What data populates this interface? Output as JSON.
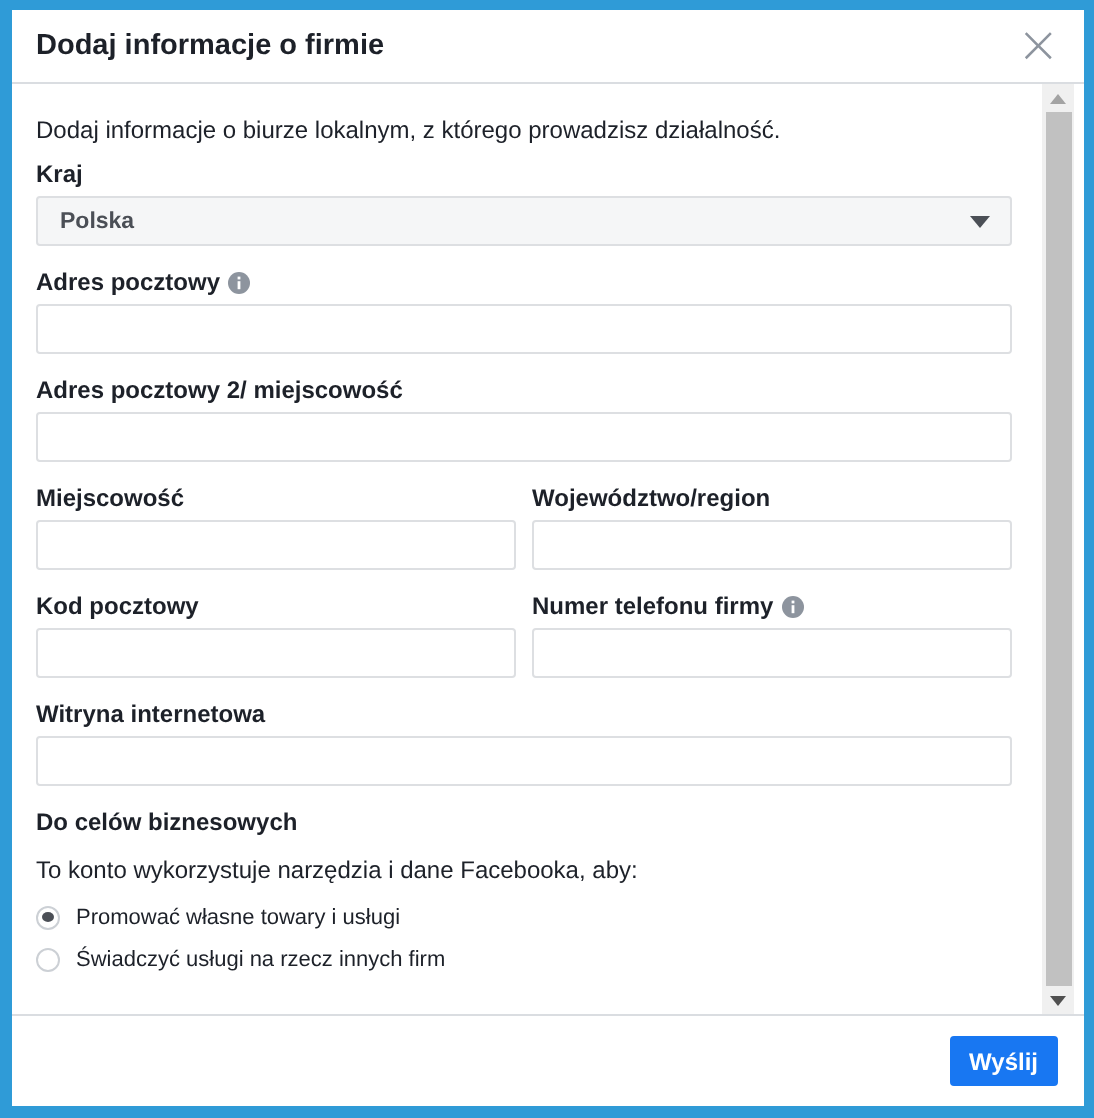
{
  "dialog": {
    "title": "Dodaj informacje o firmie",
    "close": "×"
  },
  "intro": "Dodaj informacje o biurze lokalnym, z którego prowadzisz działalność.",
  "rows": [
    {
      "fields": [
        {
          "kind": "select",
          "label": "Kraj",
          "info": false,
          "value": "Polska"
        }
      ]
    },
    {
      "fields": [
        {
          "kind": "text",
          "label": "Adres pocztowy",
          "info": true
        }
      ]
    },
    {
      "fields": [
        {
          "kind": "text",
          "label": "Adres pocztowy 2/ miejscowość",
          "info": false
        }
      ]
    },
    {
      "fields": [
        {
          "kind": "text",
          "label": "Miejscowość",
          "info": false
        },
        {
          "kind": "text",
          "label": "Województwo/region",
          "info": false
        }
      ]
    },
    {
      "fields": [
        {
          "kind": "text",
          "label": "Kod pocztowy",
          "info": false
        },
        {
          "kind": "text",
          "label": "Numer telefonu firmy",
          "info": true
        }
      ]
    },
    {
      "fields": [
        {
          "kind": "text",
          "label": "Witryna internetowa",
          "info": false
        }
      ]
    }
  ],
  "purpose": {
    "heading": "Do celów biznesowych",
    "prompt": "To konto wykorzystuje narzędzia i dane Facebooka, aby:",
    "options": [
      {
        "label": "Promować własne towary i usługi",
        "selected": true
      },
      {
        "label": "Świadczyć usługi na rzecz innych firm",
        "selected": false
      }
    ]
  },
  "buttons": [
    {
      "label": "Wyślij"
    }
  ]
}
